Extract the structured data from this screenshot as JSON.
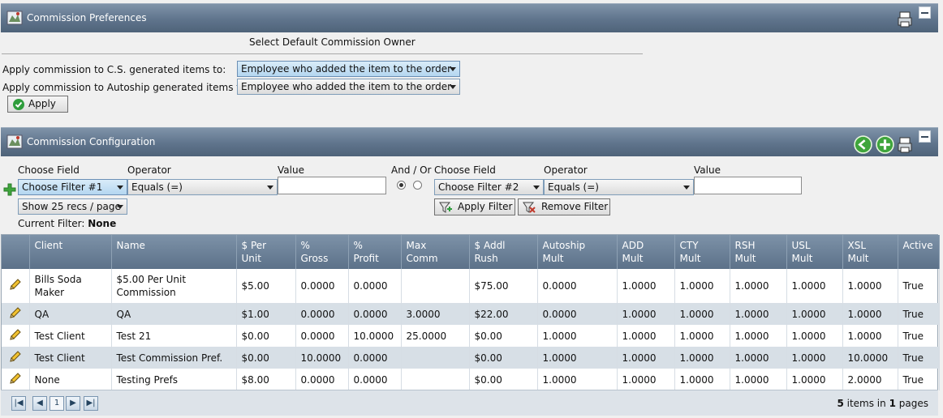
{
  "prefs": {
    "title": "Commission Preferences",
    "section_label": "Select Default Commission Owner",
    "cs_label": "Apply commission to C.S. generated items to:",
    "cs_value": "Employee who added the item to the order",
    "autoship_label": "Apply commission to Autoship generated items to:",
    "autoship_value": "Employee who added the item to the order",
    "apply_label": "Apply"
  },
  "config": {
    "title": "Commission Configuration",
    "filter1": {
      "field_header": "Choose Field",
      "operator_header": "Operator",
      "value_header": "Value",
      "field_value": "Choose Filter #1",
      "operator_value": "Equals (=)",
      "value": ""
    },
    "and_or_label": "And / Or",
    "filter2": {
      "field_header": "Choose Field",
      "operator_header": "Operator",
      "value_header": "Value",
      "field_value": "Choose Filter #2",
      "operator_value": "Equals (=)",
      "value": ""
    },
    "page_size": "Show 25 recs / page",
    "apply_filter_label": "Apply Filter",
    "remove_filter_label": "Remove Filter",
    "current_filter_label": "Current Filter:",
    "current_filter_value": "None"
  },
  "table": {
    "columns": [
      {
        "l1": "Client",
        "l2": ""
      },
      {
        "l1": "Name",
        "l2": ""
      },
      {
        "l1": "$ Per",
        "l2": "Unit"
      },
      {
        "l1": "%",
        "l2": "Gross"
      },
      {
        "l1": "%",
        "l2": "Profit"
      },
      {
        "l1": "Max",
        "l2": "Comm"
      },
      {
        "l1": "$ Addl",
        "l2": "Rush"
      },
      {
        "l1": "Autoship",
        "l2": "Mult"
      },
      {
        "l1": "ADD",
        "l2": "Mult"
      },
      {
        "l1": "CTY",
        "l2": "Mult"
      },
      {
        "l1": "RSH",
        "l2": "Mult"
      },
      {
        "l1": "USL",
        "l2": "Mult"
      },
      {
        "l1": "XSL",
        "l2": "Mult"
      },
      {
        "l1": "Active",
        "l2": ""
      }
    ],
    "rows": [
      {
        "client": "Bills Soda Maker",
        "name": "$5.00 Per Unit Commission",
        "per_unit": "$5.00",
        "gross": "0.0000",
        "profit": "0.0000",
        "max_comm": "",
        "rush": "$75.00",
        "autoship": "0.0000",
        "add": "1.0000",
        "cty": "1.0000",
        "rsh": "1.0000",
        "usl": "1.0000",
        "xsl": "1.0000",
        "active": "True"
      },
      {
        "client": "QA",
        "name": "QA",
        "per_unit": "$1.00",
        "gross": "0.0000",
        "profit": "0.0000",
        "max_comm": "3.0000",
        "rush": "$22.00",
        "autoship": "0.0000",
        "add": "1.0000",
        "cty": "1.0000",
        "rsh": "1.0000",
        "usl": "1.0000",
        "xsl": "1.0000",
        "active": "True"
      },
      {
        "client": "Test Client",
        "name": "Test 21",
        "per_unit": "$0.00",
        "gross": "0.0000",
        "profit": "10.0000",
        "max_comm": "25.0000",
        "rush": "$0.00",
        "autoship": "1.0000",
        "add": "1.0000",
        "cty": "1.0000",
        "rsh": "1.0000",
        "usl": "1.0000",
        "xsl": "1.0000",
        "active": "True"
      },
      {
        "client": "Test Client",
        "name": "Test Commission Pref.",
        "per_unit": "$0.00",
        "gross": "10.0000",
        "profit": "0.0000",
        "max_comm": "",
        "rush": "$0.00",
        "autoship": "1.0000",
        "add": "1.0000",
        "cty": "1.0000",
        "rsh": "1.0000",
        "usl": "1.0000",
        "xsl": "10.0000",
        "active": "True"
      },
      {
        "client": "None",
        "name": "Testing Prefs",
        "per_unit": "$8.00",
        "gross": "0.0000",
        "profit": "0.0000",
        "max_comm": "",
        "rush": "$0.00",
        "autoship": "1.0000",
        "add": "1.0000",
        "cty": "1.0000",
        "rsh": "1.0000",
        "usl": "1.0000",
        "xsl": "2.0000",
        "active": "True"
      }
    ]
  },
  "pager": {
    "current_page": "1",
    "total_items": "5",
    "items_text": "items in",
    "total_pages": "1",
    "pages_text": "pages"
  }
}
